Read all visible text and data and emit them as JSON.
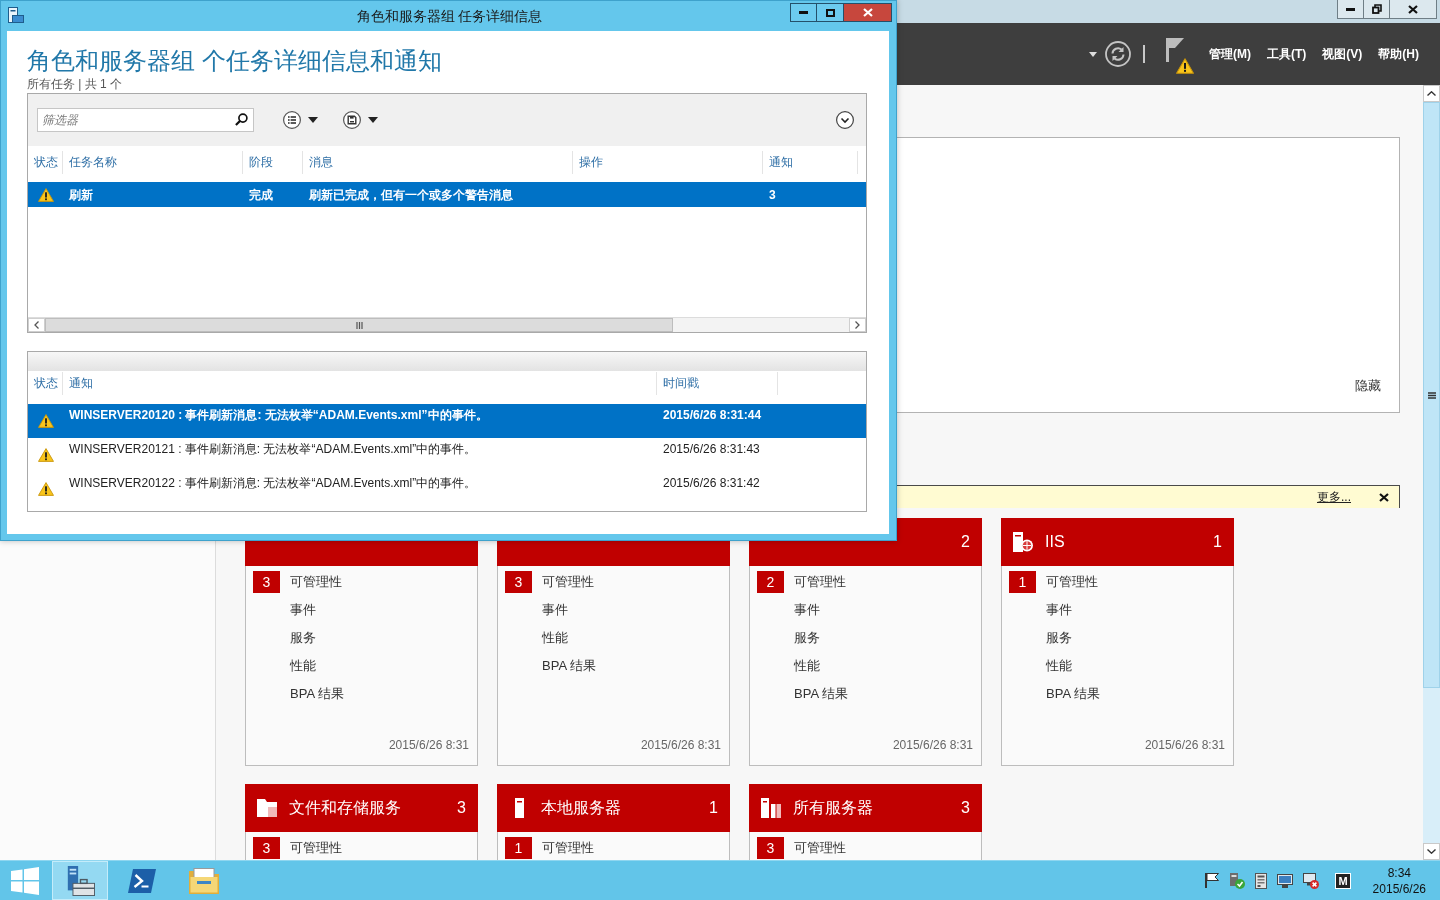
{
  "background_window": {
    "toolbar": {
      "flag_warning": true,
      "menus": [
        "管理(M)",
        "工具(T)",
        "视图(V)",
        "帮助(H)"
      ]
    },
    "welcome_panel": {
      "hide_link": "隐藏"
    },
    "notice_bar": {
      "more_link": "更多..."
    },
    "tiles": [
      {
        "items": [
          {
            "label": "可管理性",
            "badge": "3"
          },
          {
            "label": "事件"
          },
          {
            "label": "服务"
          },
          {
            "label": "性能"
          },
          {
            "label": "BPA 结果"
          }
        ],
        "timestamp": "2015/6/26 8:31"
      },
      {
        "items": [
          {
            "label": "可管理性",
            "badge": "3"
          },
          {
            "label": "事件"
          },
          {
            "label": "性能"
          },
          {
            "label": "BPA 结果"
          }
        ],
        "timestamp": "2015/6/26 8:31"
      },
      {
        "count": "2",
        "items": [
          {
            "label": "可管理性",
            "badge": "2"
          },
          {
            "label": "事件"
          },
          {
            "label": "服务"
          },
          {
            "label": "性能"
          },
          {
            "label": "BPA 结果"
          }
        ],
        "timestamp": "2015/6/26 8:31"
      },
      {
        "kind": "web",
        "title": "IIS",
        "count": "1",
        "items": [
          {
            "label": "可管理性",
            "badge": "1"
          },
          {
            "label": "事件"
          },
          {
            "label": "服务"
          },
          {
            "label": "性能"
          },
          {
            "label": "BPA 结果"
          }
        ],
        "timestamp": "2015/6/26 8:31"
      },
      {
        "kind": "folder",
        "title": "文件和存储服务",
        "count": "3",
        "items": [
          {
            "label": "可管理性",
            "badge": "3"
          }
        ]
      },
      {
        "kind": "server",
        "title": "本地服务器",
        "count": "1",
        "items": [
          {
            "label": "可管理性",
            "badge": "1"
          }
        ]
      },
      {
        "kind": "servers",
        "title": "所有服务器",
        "count": "3",
        "items": [
          {
            "label": "可管理性",
            "badge": "3"
          }
        ]
      }
    ]
  },
  "dialog": {
    "title": "角色和服务器组 任务详细信息",
    "heading": "角色和服务器组 个任务详细信息和通知",
    "summary": "所有任务 | 共 1 个",
    "filter": {
      "placeholder": "筛选器"
    },
    "tasks": {
      "columns": [
        "状态",
        "任务名称",
        "阶段",
        "消息",
        "操作",
        "通知"
      ],
      "rows": [
        {
          "kind": "warning",
          "name": "刷新",
          "stage": "完成",
          "message": "刷新已完成，但有一个或多个警告消息",
          "notifications": "3",
          "selected": true
        }
      ]
    },
    "notifications": {
      "columns": [
        "状态",
        "通知",
        "时间戳"
      ],
      "rows": [
        {
          "kind": "warning",
          "text": "WINSERVER20120 : 事件刷新消息: 无法枚举“ADAM.Events.xml”中的事件。",
          "time": "2015/6/26 8:31:44",
          "selected": true
        },
        {
          "kind": "warning",
          "text": "WINSERVER20121 : 事件刷新消息: 无法枚举“ADAM.Events.xml”中的事件。",
          "time": "2015/6/26 8:31:43",
          "selected": false
        },
        {
          "kind": "warning",
          "text": "WINSERVER20122 : 事件刷新消息: 无法枚举“ADAM.Events.xml”中的事件。",
          "time": "2015/6/26 8:31:42",
          "selected": false
        }
      ]
    }
  },
  "taskbar": {
    "apps": [
      {
        "kind": "server-manager",
        "selected": true
      },
      {
        "kind": "powershell",
        "selected": false
      },
      {
        "kind": "explorer",
        "selected": false
      }
    ],
    "input_indicator": "M",
    "clock": {
      "time": "8:34",
      "date": "2015/6/26"
    }
  }
}
